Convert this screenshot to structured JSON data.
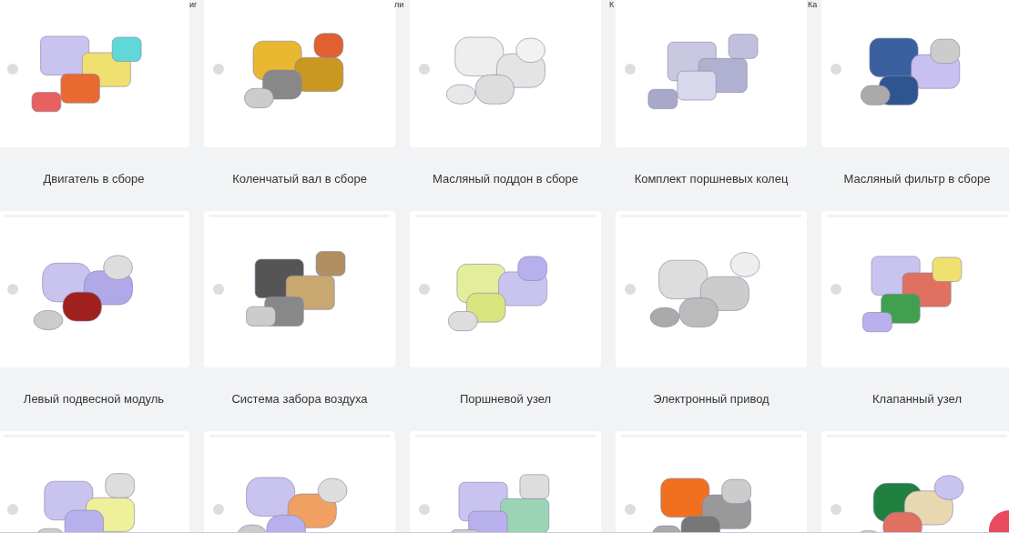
{
  "cut_labels": [
    "иг",
    "ли",
    "К",
    "Ка"
  ],
  "rows": [
    {
      "items": [
        {
          "kind": "diagram",
          "label": "Двигатель в сборе"
        },
        {
          "kind": "diagram",
          "label": "Коленчатый вал в сборе"
        },
        {
          "kind": "diagram",
          "label": "Масляный поддон в сборе"
        },
        {
          "kind": "diagram",
          "label": "Комплект поршневых колец"
        },
        {
          "kind": "diagram",
          "label": "Масляный фильтр в сборе"
        }
      ]
    },
    {
      "items": [
        {
          "kind": "diagram",
          "label": "Левый подвесной модуль"
        },
        {
          "kind": "diagram",
          "label": "Система забора воздуха"
        },
        {
          "kind": "diagram",
          "label": "Поршневой узел"
        },
        {
          "kind": "diagram",
          "label": "Электронный привод"
        },
        {
          "kind": "diagram",
          "label": "Клапанный узел"
        }
      ]
    },
    {
      "items": [
        {
          "kind": "diagram"
        },
        {
          "kind": "diagram"
        },
        {
          "kind": "diagram"
        },
        {
          "kind": "diagram"
        },
        {
          "kind": "diagram"
        }
      ]
    }
  ]
}
